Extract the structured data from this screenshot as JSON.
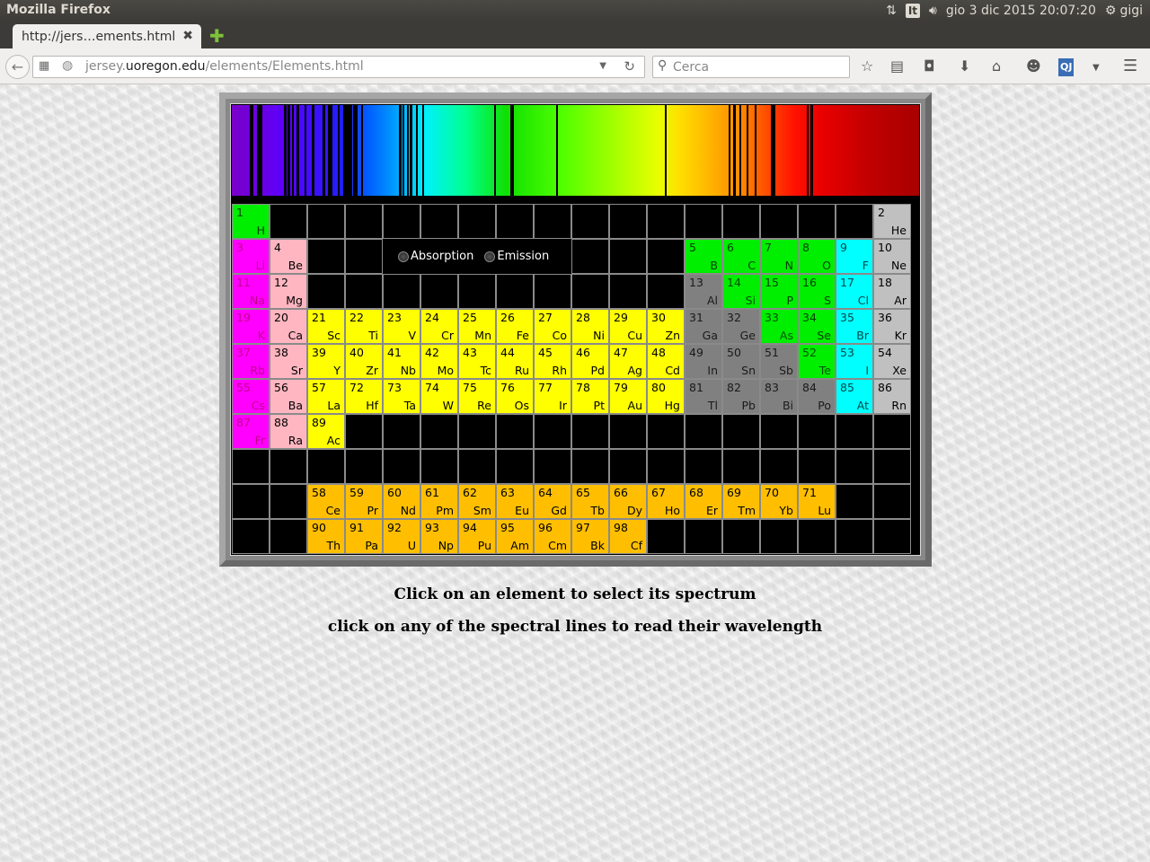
{
  "panel": {
    "app_name": "Mozilla Firefox",
    "keyboard_layout": "It",
    "clock": "gio  3 dic 2015 20:07:20",
    "user": "gigi"
  },
  "tab": {
    "title": "http://jers…ements.html",
    "close": "✖",
    "new_tab": "✚"
  },
  "nav": {
    "url_prefix": "jersey.",
    "url_domain": "uoregon.edu",
    "url_suffix": "/elements/Elements.html",
    "search_placeholder": "Cerca"
  },
  "spectrum_lines_nm": [
    "line-1",
    "line-2",
    "line-3",
    "line-4",
    "line-5",
    "line-6",
    "line-7",
    "line-8",
    "line-9",
    "line-10",
    "line-11",
    "line-12",
    "line-13",
    "line-14",
    "line-15",
    "line-16",
    "line-17",
    "line-18",
    "line-19",
    "line-20",
    "line-21",
    "line-22",
    "line-23",
    "line-24",
    "line-25",
    "line-26",
    "line-27",
    "line-28",
    "line-29",
    "line-30"
  ],
  "modes": {
    "absorption": "Absorption",
    "emission": "Emission"
  },
  "elements": [
    {
      "n": "1",
      "s": "H",
      "c": "hydrogen",
      "col": 0,
      "row": 0
    },
    {
      "n": "2",
      "s": "He",
      "c": "noble",
      "col": 17,
      "row": 0
    },
    {
      "n": "3",
      "s": "Li",
      "c": "alkali",
      "col": 0,
      "row": 1
    },
    {
      "n": "4",
      "s": "Be",
      "c": "alkaline",
      "col": 1,
      "row": 1
    },
    {
      "n": "5",
      "s": "B",
      "c": "nonmetal",
      "col": 12,
      "row": 1
    },
    {
      "n": "6",
      "s": "C",
      "c": "nonmetal",
      "col": 13,
      "row": 1
    },
    {
      "n": "7",
      "s": "N",
      "c": "nonmetal",
      "col": 14,
      "row": 1
    },
    {
      "n": "8",
      "s": "O",
      "c": "nonmetal",
      "col": 15,
      "row": 1
    },
    {
      "n": "9",
      "s": "F",
      "c": "halogen",
      "col": 16,
      "row": 1
    },
    {
      "n": "10",
      "s": "Ne",
      "c": "noble",
      "col": 17,
      "row": 1
    },
    {
      "n": "11",
      "s": "Na",
      "c": "alkali",
      "col": 0,
      "row": 2
    },
    {
      "n": "12",
      "s": "Mg",
      "c": "alkaline",
      "col": 1,
      "row": 2
    },
    {
      "n": "13",
      "s": "Al",
      "c": "poor",
      "col": 12,
      "row": 2
    },
    {
      "n": "14",
      "s": "Si",
      "c": "metalloid",
      "col": 13,
      "row": 2
    },
    {
      "n": "15",
      "s": "P",
      "c": "nonmetal",
      "col": 14,
      "row": 2
    },
    {
      "n": "16",
      "s": "S",
      "c": "nonmetal",
      "col": 15,
      "row": 2
    },
    {
      "n": "17",
      "s": "Cl",
      "c": "halogen",
      "col": 16,
      "row": 2
    },
    {
      "n": "18",
      "s": "Ar",
      "c": "noble",
      "col": 17,
      "row": 2
    },
    {
      "n": "19",
      "s": "K",
      "c": "alkali",
      "col": 0,
      "row": 3
    },
    {
      "n": "20",
      "s": "Ca",
      "c": "alkaline",
      "col": 1,
      "row": 3
    },
    {
      "n": "21",
      "s": "Sc",
      "c": "transition",
      "col": 2,
      "row": 3
    },
    {
      "n": "22",
      "s": "Ti",
      "c": "transition",
      "col": 3,
      "row": 3
    },
    {
      "n": "23",
      "s": "V",
      "c": "transition",
      "col": 4,
      "row": 3
    },
    {
      "n": "24",
      "s": "Cr",
      "c": "transition",
      "col": 5,
      "row": 3
    },
    {
      "n": "25",
      "s": "Mn",
      "c": "transition",
      "col": 6,
      "row": 3
    },
    {
      "n": "26",
      "s": "Fe",
      "c": "transition",
      "col": 7,
      "row": 3
    },
    {
      "n": "27",
      "s": "Co",
      "c": "transition",
      "col": 8,
      "row": 3
    },
    {
      "n": "28",
      "s": "Ni",
      "c": "transition",
      "col": 9,
      "row": 3
    },
    {
      "n": "29",
      "s": "Cu",
      "c": "transition",
      "col": 10,
      "row": 3
    },
    {
      "n": "30",
      "s": "Zn",
      "c": "transition",
      "col": 11,
      "row": 3
    },
    {
      "n": "31",
      "s": "Ga",
      "c": "poor",
      "col": 12,
      "row": 3
    },
    {
      "n": "32",
      "s": "Ge",
      "c": "poor",
      "col": 13,
      "row": 3
    },
    {
      "n": "33",
      "s": "As",
      "c": "metalloid",
      "col": 14,
      "row": 3
    },
    {
      "n": "34",
      "s": "Se",
      "c": "nonmetal",
      "col": 15,
      "row": 3
    },
    {
      "n": "35",
      "s": "Br",
      "c": "halogen",
      "col": 16,
      "row": 3
    },
    {
      "n": "36",
      "s": "Kr",
      "c": "noble",
      "col": 17,
      "row": 3
    },
    {
      "n": "37",
      "s": "Rb",
      "c": "alkali",
      "col": 0,
      "row": 4
    },
    {
      "n": "38",
      "s": "Sr",
      "c": "alkaline",
      "col": 1,
      "row": 4
    },
    {
      "n": "39",
      "s": "Y",
      "c": "transition",
      "col": 2,
      "row": 4
    },
    {
      "n": "40",
      "s": "Zr",
      "c": "transition",
      "col": 3,
      "row": 4
    },
    {
      "n": "41",
      "s": "Nb",
      "c": "transition",
      "col": 4,
      "row": 4
    },
    {
      "n": "42",
      "s": "Mo",
      "c": "transition",
      "col": 5,
      "row": 4
    },
    {
      "n": "43",
      "s": "Tc",
      "c": "transition",
      "col": 6,
      "row": 4
    },
    {
      "n": "44",
      "s": "Ru",
      "c": "transition",
      "col": 7,
      "row": 4
    },
    {
      "n": "45",
      "s": "Rh",
      "c": "transition",
      "col": 8,
      "row": 4
    },
    {
      "n": "46",
      "s": "Pd",
      "c": "transition",
      "col": 9,
      "row": 4
    },
    {
      "n": "47",
      "s": "Ag",
      "c": "transition",
      "col": 10,
      "row": 4
    },
    {
      "n": "48",
      "s": "Cd",
      "c": "transition",
      "col": 11,
      "row": 4
    },
    {
      "n": "49",
      "s": "In",
      "c": "poor",
      "col": 12,
      "row": 4
    },
    {
      "n": "50",
      "s": "Sn",
      "c": "poor",
      "col": 13,
      "row": 4
    },
    {
      "n": "51",
      "s": "Sb",
      "c": "poor",
      "col": 14,
      "row": 4
    },
    {
      "n": "52",
      "s": "Te",
      "c": "metalloid",
      "col": 15,
      "row": 4
    },
    {
      "n": "53",
      "s": "I",
      "c": "halogen",
      "col": 16,
      "row": 4
    },
    {
      "n": "54",
      "s": "Xe",
      "c": "noble",
      "col": 17,
      "row": 4
    },
    {
      "n": "55",
      "s": "Cs",
      "c": "alkali",
      "col": 0,
      "row": 5
    },
    {
      "n": "56",
      "s": "Ba",
      "c": "alkaline",
      "col": 1,
      "row": 5
    },
    {
      "n": "57",
      "s": "La",
      "c": "transition",
      "col": 2,
      "row": 5
    },
    {
      "n": "72",
      "s": "Hf",
      "c": "transition",
      "col": 3,
      "row": 5
    },
    {
      "n": "73",
      "s": "Ta",
      "c": "transition",
      "col": 4,
      "row": 5
    },
    {
      "n": "74",
      "s": "W",
      "c": "transition",
      "col": 5,
      "row": 5
    },
    {
      "n": "75",
      "s": "Re",
      "c": "transition",
      "col": 6,
      "row": 5
    },
    {
      "n": "76",
      "s": "Os",
      "c": "transition",
      "col": 7,
      "row": 5
    },
    {
      "n": "77",
      "s": "Ir",
      "c": "transition",
      "col": 8,
      "row": 5
    },
    {
      "n": "78",
      "s": "Pt",
      "c": "transition",
      "col": 9,
      "row": 5
    },
    {
      "n": "79",
      "s": "Au",
      "c": "transition",
      "col": 10,
      "row": 5
    },
    {
      "n": "80",
      "s": "Hg",
      "c": "transition",
      "col": 11,
      "row": 5
    },
    {
      "n": "81",
      "s": "Tl",
      "c": "poor",
      "col": 12,
      "row": 5
    },
    {
      "n": "82",
      "s": "Pb",
      "c": "poor",
      "col": 13,
      "row": 5
    },
    {
      "n": "83",
      "s": "Bi",
      "c": "poor",
      "col": 14,
      "row": 5
    },
    {
      "n": "84",
      "s": "Po",
      "c": "poor",
      "col": 15,
      "row": 5
    },
    {
      "n": "85",
      "s": "At",
      "c": "halogen",
      "col": 16,
      "row": 5
    },
    {
      "n": "86",
      "s": "Rn",
      "c": "noble",
      "col": 17,
      "row": 5
    },
    {
      "n": "87",
      "s": "Fr",
      "c": "alkali",
      "col": 0,
      "row": 6
    },
    {
      "n": "88",
      "s": "Ra",
      "c": "alkaline",
      "col": 1,
      "row": 6
    },
    {
      "n": "89",
      "s": "Ac",
      "c": "transition",
      "col": 2,
      "row": 6
    },
    {
      "n": "58",
      "s": "Ce",
      "c": "lanthanide",
      "col": 2,
      "row": 8
    },
    {
      "n": "59",
      "s": "Pr",
      "c": "lanthanide",
      "col": 3,
      "row": 8
    },
    {
      "n": "60",
      "s": "Nd",
      "c": "lanthanide",
      "col": 4,
      "row": 8
    },
    {
      "n": "61",
      "s": "Pm",
      "c": "lanthanide",
      "col": 5,
      "row": 8
    },
    {
      "n": "62",
      "s": "Sm",
      "c": "lanthanide",
      "col": 6,
      "row": 8
    },
    {
      "n": "63",
      "s": "Eu",
      "c": "lanthanide",
      "col": 7,
      "row": 8
    },
    {
      "n": "64",
      "s": "Gd",
      "c": "lanthanide",
      "col": 8,
      "row": 8
    },
    {
      "n": "65",
      "s": "Tb",
      "c": "lanthanide",
      "col": 9,
      "row": 8
    },
    {
      "n": "66",
      "s": "Dy",
      "c": "lanthanide",
      "col": 10,
      "row": 8
    },
    {
      "n": "67",
      "s": "Ho",
      "c": "lanthanide",
      "col": 11,
      "row": 8
    },
    {
      "n": "68",
      "s": "Er",
      "c": "lanthanide",
      "col": 12,
      "row": 8
    },
    {
      "n": "69",
      "s": "Tm",
      "c": "lanthanide",
      "col": 13,
      "row": 8
    },
    {
      "n": "70",
      "s": "Yb",
      "c": "lanthanide",
      "col": 14,
      "row": 8
    },
    {
      "n": "71",
      "s": "Lu",
      "c": "lanthanide",
      "col": 15,
      "row": 8
    },
    {
      "n": "90",
      "s": "Th",
      "c": "lanthanide",
      "col": 2,
      "row": 9
    },
    {
      "n": "91",
      "s": "Pa",
      "c": "lanthanide",
      "col": 3,
      "row": 9
    },
    {
      "n": "92",
      "s": "U",
      "c": "lanthanide",
      "col": 4,
      "row": 9
    },
    {
      "n": "93",
      "s": "Np",
      "c": "lanthanide",
      "col": 5,
      "row": 9
    },
    {
      "n": "94",
      "s": "Pu",
      "c": "lanthanide",
      "col": 6,
      "row": 9
    },
    {
      "n": "95",
      "s": "Am",
      "c": "lanthanide",
      "col": 7,
      "row": 9
    },
    {
      "n": "96",
      "s": "Cm",
      "c": "lanthanide",
      "col": 8,
      "row": 9
    },
    {
      "n": "97",
      "s": "Bk",
      "c": "lanthanide",
      "col": 9,
      "row": 9
    },
    {
      "n": "98",
      "s": "Cf",
      "c": "lanthanide",
      "col": 10,
      "row": 9
    }
  ],
  "captions": {
    "line1": "Click on an element to select its spectrum",
    "line2": "click on any of the spectral lines to read their wavelength"
  }
}
